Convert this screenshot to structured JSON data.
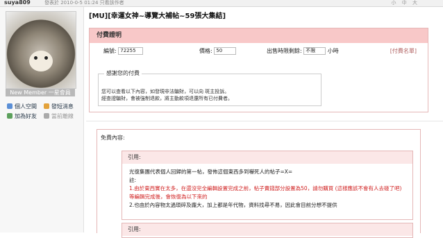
{
  "topbar": {
    "user": "suya809",
    "posted": "發表於 2010-0-5 01:24 只看該作者",
    "controls": "小 中 大"
  },
  "sidebar": {
    "member": "New Member 一星會員",
    "actions": [
      {
        "label": "個人空間",
        "icon": "home-icon",
        "color": "#5b8fd6"
      },
      {
        "label": "發短消息",
        "icon": "message-icon",
        "color": "#e3a23b"
      },
      {
        "label": "加為好友",
        "icon": "add-friend-icon",
        "color": "#5ca05c"
      },
      {
        "label": "當前離線",
        "icon": "offline-icon",
        "color": "#aaaaaa"
      }
    ]
  },
  "post": {
    "title": "[MU][幸運女神~導覽大補帖~59張大集結]"
  },
  "pay": {
    "head": "付費證明",
    "id_label": "編號:",
    "id_value": "72255",
    "price_label": "價格:",
    "price_value": "50",
    "time_label": "出售時限剩餘:",
    "time_value": "不限",
    "time_unit": "小時",
    "link": "[付費名單]",
    "thanks_legend": "感謝您的付費",
    "thanks_text1": "您可以查看以下內容，如發現非法騙財，可以向 斑主投訴。",
    "thanks_text2": "經查證騙財，會被強制退款，將主動款項退還所有已付費者。"
  },
  "free": {
    "label": "免費內容:",
    "quote1_head": "引用:",
    "quote1_line1": "光復集團代表個人回歸的第一帖，發佈這個東西多到嚇死人的帖子=X=",
    "quote1_line2": "註:",
    "quote1_line3": "1.由於東西實在太多，在還沒完全編輯設置完成之前，帖子賣錢部分設置為50，請勿購買 (這樣應該不會有人去碰了吧)等編輯完成後，會恢復為以下來的",
    "quote1_line4": "2.也由於內容物太過瑣碎及龐大，加上都是年代物，資料找尋不易，因此會目前分想不提供",
    "quote2_head": "引用:"
  }
}
